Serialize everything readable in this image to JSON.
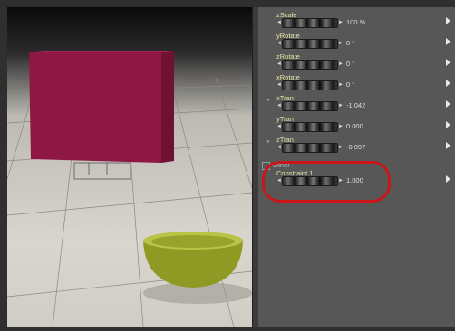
{
  "params": [
    {
      "label": "zScale",
      "value": "100 %",
      "dot": false
    },
    {
      "label": "yRotate",
      "value": "0 °",
      "dot": false
    },
    {
      "label": "zRotate",
      "value": "0 °",
      "dot": false
    },
    {
      "label": "xRotate",
      "value": "0 °",
      "dot": false
    },
    {
      "label": "xTran",
      "value": "-1.042",
      "dot": true
    },
    {
      "label": "yTran",
      "value": "0.000",
      "dot": false
    },
    {
      "label": "zTran",
      "value": "-0.097",
      "dot": true
    }
  ],
  "group": {
    "toggle": "−",
    "title": "Other"
  },
  "constraint": {
    "label": "Constraint 1",
    "value": "1.000"
  },
  "colors": {
    "highlight": "#c8161b",
    "label": "#e6e4a6",
    "cube": "#8e1744",
    "bowl": "#8f9a24"
  },
  "icons": {
    "dial_left": "◄",
    "dial_right": "►",
    "dot": "●"
  }
}
